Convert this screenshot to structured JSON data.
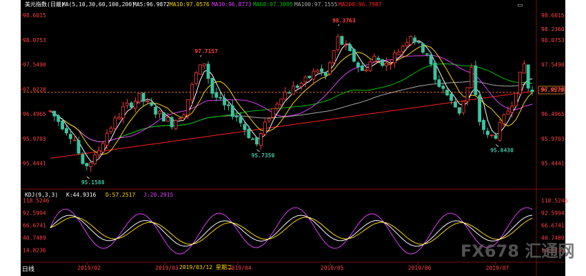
{
  "chart_data": {
    "type": "candlestick",
    "instrument": "美元指数(日线)",
    "indicators_header": {
      "ma_params": "MA(5,10,30,60,100,200)",
      "ma5": "MA5:96.9872",
      "ma10": "MA10:97.0576",
      "ma30": "MA30:96.8773",
      "ma60": "MA60:97.3095",
      "ma100": "MA100:97.1555",
      "ma200": "MA200:96.7987"
    },
    "price_axis": {
      "ticks": [
        "98.6015",
        "98.0753",
        "97.5490",
        "97.0228",
        "96.4965",
        "95.9703",
        "95.4441"
      ],
      "ylim": [
        95.1,
        98.72
      ]
    },
    "right_tags": {
      "prev_high": "98.2360",
      "current": "96.9570"
    },
    "current_price": 96.957,
    "annotations": [
      {
        "label": "95.1588",
        "value": 95.1588,
        "kind": "low"
      },
      {
        "label": "97.7157",
        "value": 97.7157,
        "kind": "high"
      },
      {
        "label": "95.7350",
        "value": 95.735,
        "kind": "low"
      },
      {
        "label": "98.3763",
        "value": 98.3763,
        "kind": "high"
      },
      {
        "label": "95.8430",
        "value": 95.843,
        "kind": "low"
      }
    ],
    "kdj": {
      "header": "KDJ(9,3,3)",
      "k_label": "K:44.9316",
      "d_label": "D:57.2517",
      "j_label": "J:20.2915",
      "ticks": [
        "118.5246",
        "92.5994",
        "66.6741",
        "40.7489",
        "14.8236"
      ],
      "ylim": [
        -5,
        125
      ]
    },
    "x_labels": [
      "2019/02",
      "2019/03",
      "2019/04",
      "2019/05",
      "2019/06",
      "2019/07"
    ],
    "cursor_date": "2019/03/12 星期二",
    "period_tab": "日线",
    "watermark": "FX678 汇通网",
    "colors": {
      "up": "#ff3c3c",
      "down": "#3cc3a0",
      "ma5": "#ffffff",
      "ma10": "#ffd700",
      "ma30": "#e040fb",
      "ma60": "#00c000",
      "ma100": "#aaaaaa",
      "ma200": "#ff2020",
      "k": "#ffffff",
      "d": "#ffd700",
      "j": "#e040fb"
    }
  }
}
